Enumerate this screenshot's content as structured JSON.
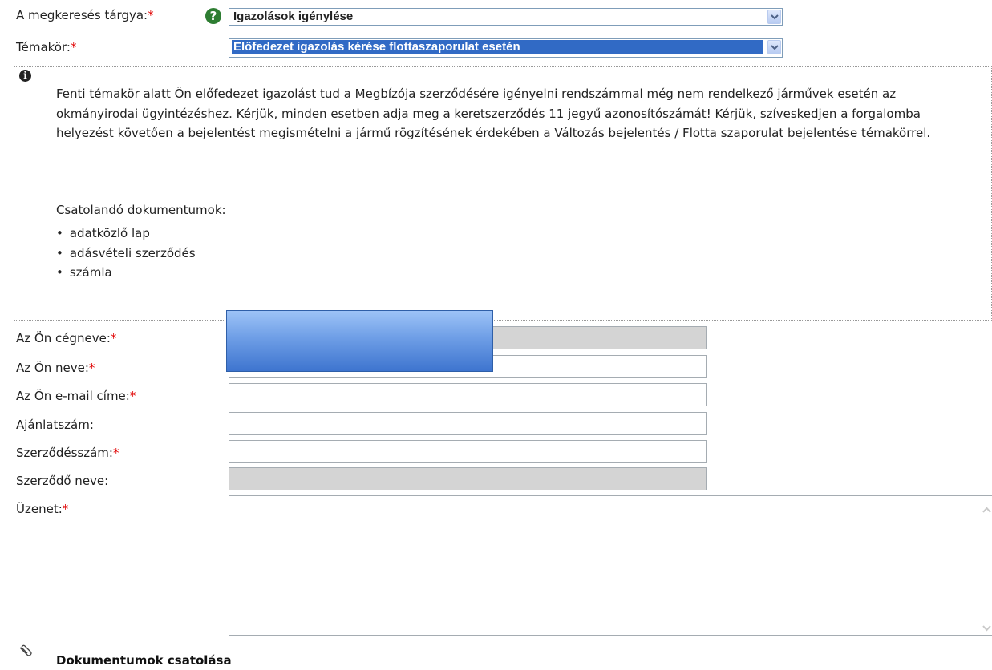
{
  "subject": {
    "label": "A megkeresés tárgya:",
    "required_mark": "*",
    "help_icon": "question-circle-icon",
    "selected": "Igazolások igénylése"
  },
  "topic": {
    "label": "Témakör:",
    "required_mark": "*",
    "selected": "Előfedezet igazolás kérése flottaszaporulat esetén"
  },
  "info": {
    "icon": "info-circle-icon",
    "text": "Fenti témakör alatt Ön előfedezet igazolást tud a Megbízója szerződésére igényelni rendszámmal még nem rendelkező járművek esetén az okmányirodai ügyintézéshez. Kérjük, minden esetben adja meg a keretszerződés 11 jegyű azonosítószámát! Kérjük, szíveskedjen a forgalomba helyezést követően a bejelentést megismételni a jármű rögzítésének érdekében a Változás bejelentés / Flotta szaporulat bejelentése témakörrel.",
    "docs_title": "Csatolandó dokumentumok:",
    "docs": [
      "adatközlő lap",
      "adásvételi szerződés",
      "számla"
    ]
  },
  "form": {
    "company": {
      "label": "Az Ön cégneve:",
      "required_mark": "*",
      "value": ""
    },
    "name": {
      "label": "Az Ön neve:",
      "required_mark": "*",
      "value": ""
    },
    "email": {
      "label": "Az Ön e-mail címe:",
      "required_mark": "*",
      "value": ""
    },
    "offer": {
      "label": "Ajánlatszám:",
      "value": ""
    },
    "contract": {
      "label": "Szerződésszám:",
      "required_mark": "*",
      "value": ""
    },
    "contractor": {
      "label": "Szerződő neve:",
      "value": ""
    },
    "message": {
      "label": "Üzenet:",
      "required_mark": "*",
      "value": ""
    }
  },
  "attachments": {
    "icon": "paperclip-icon",
    "title": "Dokumentumok csatolása"
  },
  "colors": {
    "required": "#e00000",
    "selection_highlight": "#316ac5",
    "disabled_field": "#d4d4d4",
    "help_icon": "#2e7d32"
  }
}
